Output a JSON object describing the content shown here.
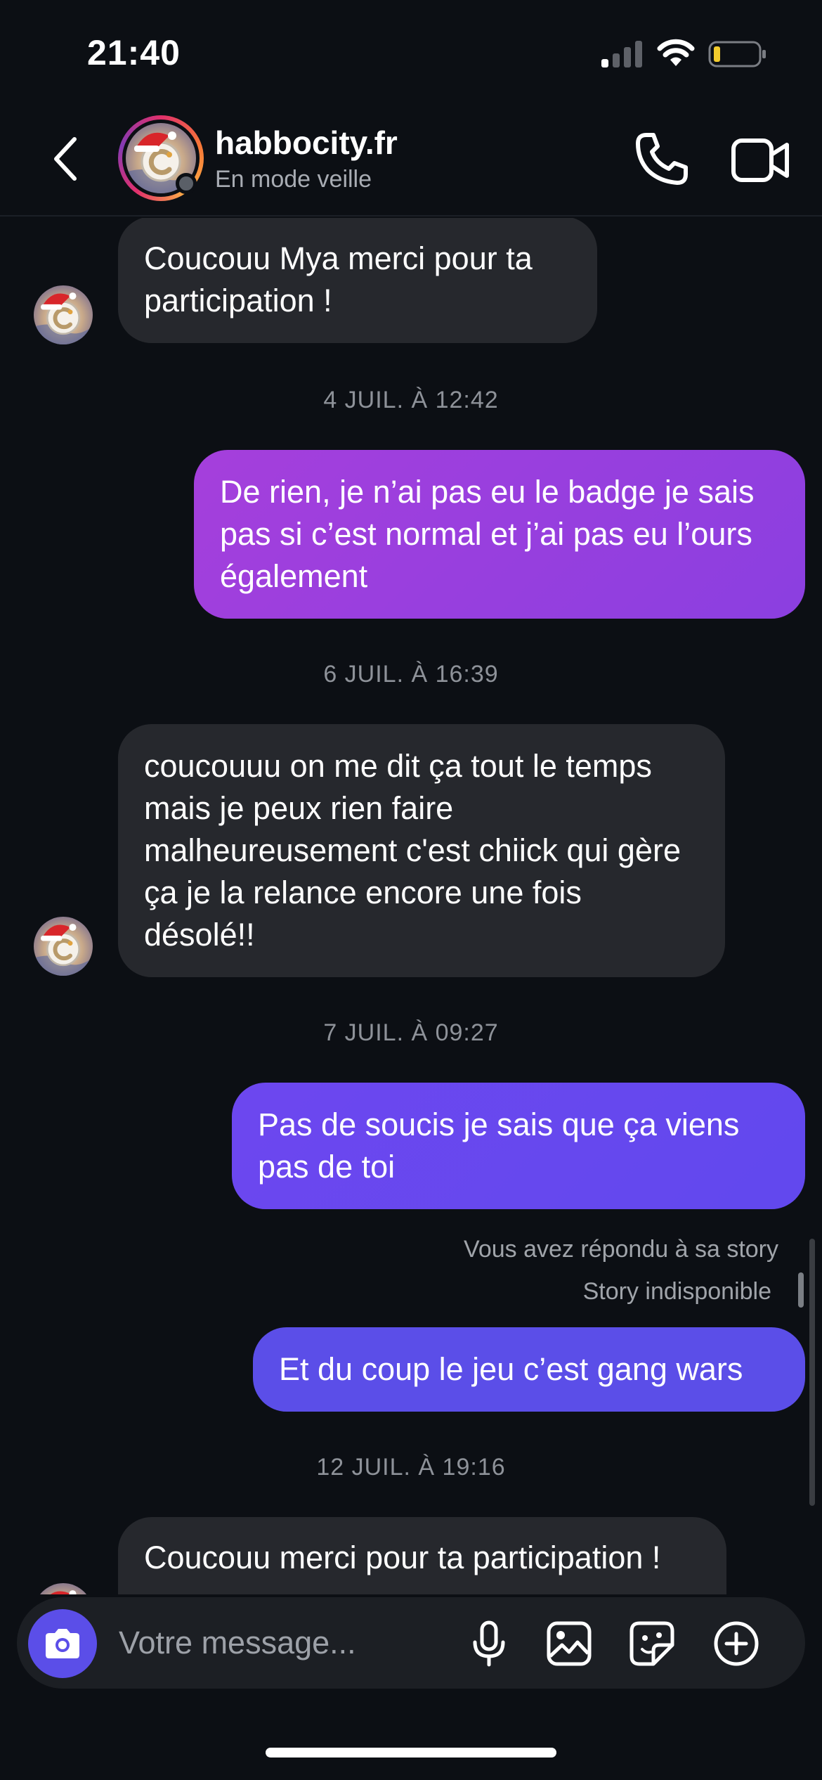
{
  "status_bar": {
    "time": "21:40",
    "icons": [
      "cellular-signal-icon",
      "wifi-icon",
      "battery-low-icon"
    ]
  },
  "header": {
    "contact_name": "habbocity.fr",
    "contact_status": "En mode veille",
    "icons": [
      "back-chevron-icon",
      "phone-icon",
      "video-camera-icon"
    ]
  },
  "thread": {
    "messages": [
      {
        "type": "in",
        "text": "Coucouu Mya merci pour ta participation !"
      },
      {
        "type": "date",
        "text": "4 JUIL. À 12:42"
      },
      {
        "type": "out",
        "text": "De rien, je n’ai pas eu le badge je sais pas si c’est normal et j’ai pas eu l’ours également"
      },
      {
        "type": "date",
        "text": "6 JUIL. À 16:39"
      },
      {
        "type": "in",
        "text": "coucouuu on me dit ça tout le temps mais je peux rien faire malheureusement c'est chiick qui gère ça je la relance encore une fois désolé!!"
      },
      {
        "type": "date",
        "text": "7 JUIL. À 09:27"
      },
      {
        "type": "out",
        "text": "Pas de soucis je sais que ça viens pas de toi"
      },
      {
        "type": "story_reply",
        "reply_label": "Vous avez répondu à sa story",
        "story_status": "Story indisponible"
      },
      {
        "type": "out",
        "text": "Et du coup le jeu c’est gang wars"
      },
      {
        "type": "date",
        "text": "12 JUIL. À 19:16"
      },
      {
        "type": "in",
        "text": "Coucouu merci pour ta participation !"
      }
    ]
  },
  "composer": {
    "placeholder": "Votre message...",
    "icons": [
      "camera-icon",
      "microphone-icon",
      "gallery-icon",
      "sticker-icon",
      "add-icon"
    ]
  },
  "colors": {
    "background": "#0c0f14",
    "incoming_bubble": "#26282d",
    "outgoing_purple": "#9a3fdc",
    "outgoing_violet": "#6a47ef",
    "outgoing_indigo": "#5b4ee8",
    "camera_button": "#5b4ee8"
  }
}
